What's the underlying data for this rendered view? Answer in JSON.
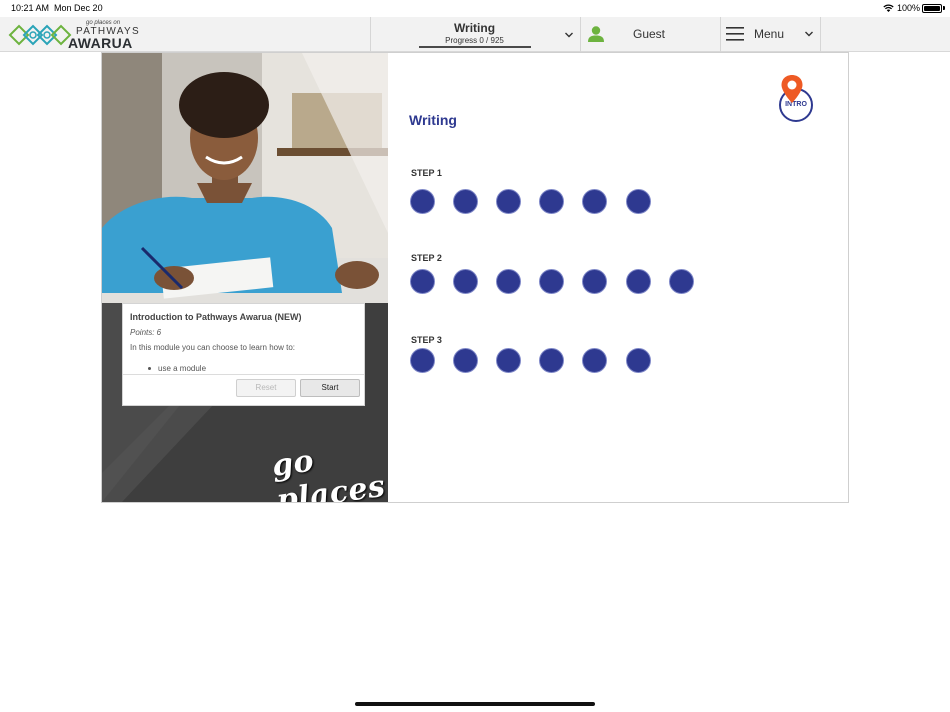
{
  "status_bar": {
    "time": "10:21 AM",
    "date": "Mon Dec 20",
    "battery": "100%"
  },
  "logo": {
    "tagline": "go places on",
    "line1": "PATHWAYS",
    "line2": "AWARUA"
  },
  "header": {
    "module_title": "Writing",
    "progress_text": "Progress  0 / 925",
    "progress_fraction": 0,
    "user": "Guest",
    "menu_label": "Menu"
  },
  "colors": {
    "accent_navy": "#2e3990",
    "brand_green": "#6db33f",
    "pin_orange": "#ee5a24"
  },
  "left_panel": {
    "slogan": "go places"
  },
  "card": {
    "title": "Introduction to Pathways Awarua (NEW)",
    "points": "Points: 6",
    "description": "In this module you can choose to learn how to:",
    "bullet": "use a module",
    "reset_label": "Reset",
    "start_label": "Start"
  },
  "content": {
    "title": "Writing",
    "intro_label": "INTRO",
    "steps": [
      {
        "label": "STEP 1",
        "dots": 6
      },
      {
        "label": "STEP 2",
        "dots": 7
      },
      {
        "label": "STEP 3",
        "dots": 6
      }
    ]
  },
  "icons": {
    "wifi": "wifi-icon",
    "battery": "battery-icon",
    "chevron": "chevron-down-icon",
    "user": "user-icon",
    "menu": "hamburger-icon",
    "pin": "location-pin-icon"
  }
}
